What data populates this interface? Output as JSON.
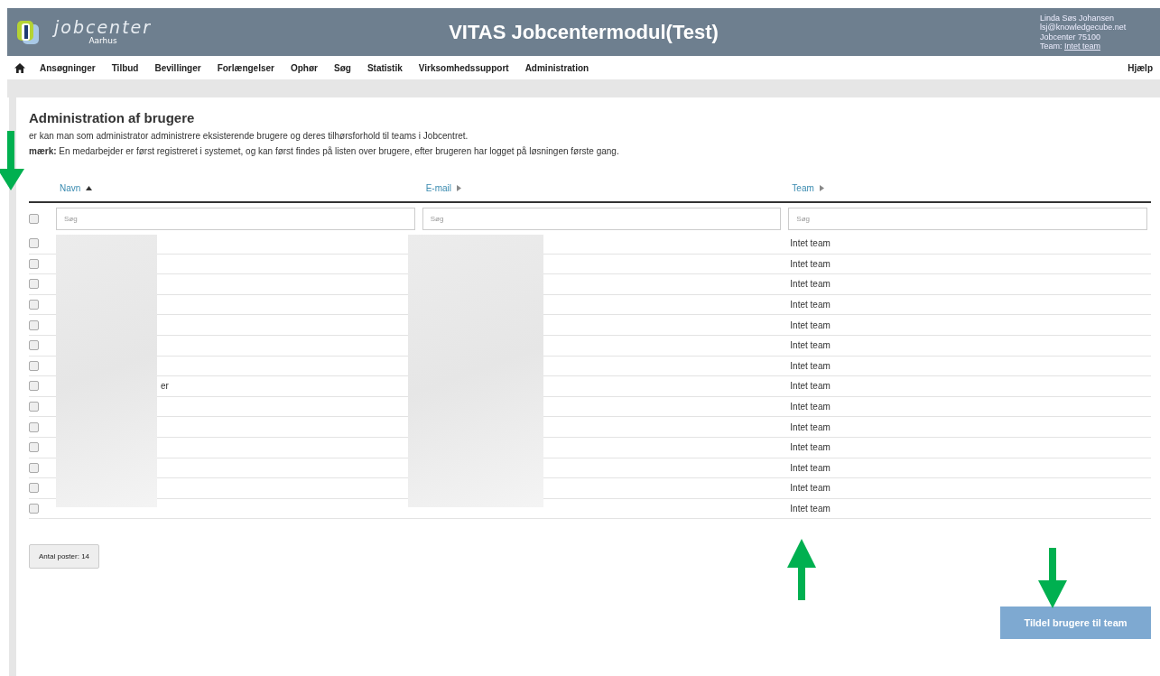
{
  "header": {
    "logo_text": "jobcenter",
    "logo_sub": "Aarhus",
    "title": "VITAS Jobcentermodul(Test)",
    "user": {
      "name": "Linda Søs Johansen",
      "email": "lsj@knowledgecube.net",
      "office": "Jobcenter 75100",
      "team_label": "Team:",
      "team_link": "Intet team"
    }
  },
  "nav": {
    "items": [
      "Ansøgninger",
      "Tilbud",
      "Bevillinger",
      "Forlængelser",
      "Ophør",
      "Søg",
      "Statistik",
      "Virksomhedssupport",
      "Administration"
    ],
    "help": "Hjælp"
  },
  "page": {
    "title": "Administration af brugere",
    "intro": "er kan man som administrator administrere eksisterende brugere og deres tilhørsforhold til teams i Jobcentret.",
    "note": "**mærk:** En medarbejder er først registreret i systemet, og kan først findes på listen over brugere, efter brugeren har logget på løsningen første gang."
  },
  "table": {
    "select_all_checked": false,
    "columns": [
      {
        "label": "Navn",
        "sorted": true,
        "filter_placeholder": "Søg"
      },
      {
        "label": "E-mail",
        "sorted": false,
        "filter_placeholder": "Søg"
      },
      {
        "label": "Team",
        "sorted": false,
        "filter_placeholder": "Søg"
      }
    ],
    "rows": [
      {
        "checked": false,
        "team": "Intet team"
      },
      {
        "checked": false,
        "team": "Intet team"
      },
      {
        "checked": false,
        "team": "Intet team"
      },
      {
        "checked": false,
        "team": "Intet team"
      },
      {
        "checked": false,
        "team": "Intet team"
      },
      {
        "checked": false,
        "team": "Intet team"
      },
      {
        "checked": false,
        "team": "Intet team"
      },
      {
        "checked": false,
        "name": "er",
        "team": "Intet team"
      },
      {
        "checked": false,
        "team": "Intet team"
      },
      {
        "checked": false,
        "team": "Intet team"
      },
      {
        "checked": false,
        "team": "Intet team"
      },
      {
        "checked": false,
        "team": "Intet team"
      },
      {
        "checked": false,
        "team": "Intet team"
      },
      {
        "checked": false,
        "team": "Intet team"
      }
    ]
  },
  "record_count": "Antal poster: 14",
  "assign_button": "Tildel brugere til team"
}
